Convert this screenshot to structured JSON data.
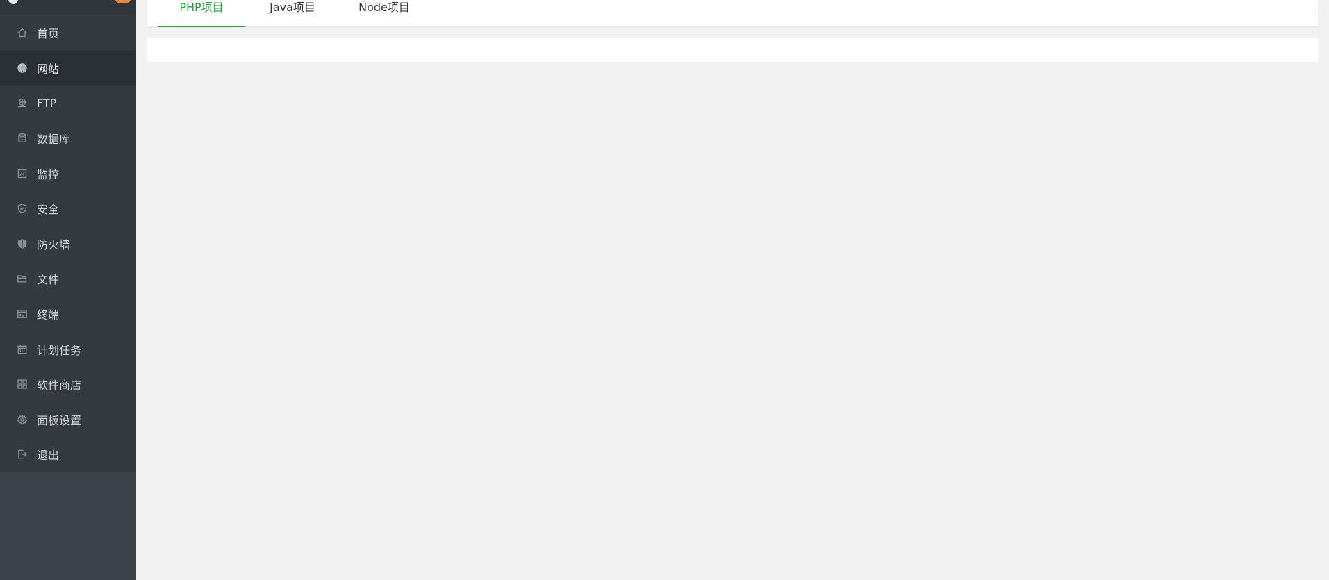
{
  "theme": {
    "sidebar_bg": "#343a40",
    "sidebar_active_bg": "#2a3036",
    "accent": "#20a53a",
    "badge": "#f0883a",
    "page_bg": "#f1f1f1"
  },
  "sidebar": {
    "items": [
      {
        "label": "首页",
        "icon": "home-icon",
        "active": false
      },
      {
        "label": "网站",
        "icon": "globe-icon",
        "active": true
      },
      {
        "label": "FTP",
        "icon": "ftp-icon",
        "active": false
      },
      {
        "label": "数据库",
        "icon": "database-icon",
        "active": false
      },
      {
        "label": "监控",
        "icon": "monitor-chart-icon",
        "active": false
      },
      {
        "label": "安全",
        "icon": "shield-check-icon",
        "active": false
      },
      {
        "label": "防火墙",
        "icon": "firewall-shield-icon",
        "active": false
      },
      {
        "label": "文件",
        "icon": "folder-icon",
        "active": false
      },
      {
        "label": "终端",
        "icon": "terminal-icon",
        "active": false
      },
      {
        "label": "计划任务",
        "icon": "calendar-icon",
        "active": false
      },
      {
        "label": "软件商店",
        "icon": "apps-grid-icon",
        "active": false
      },
      {
        "label": "面板设置",
        "icon": "gear-icon",
        "active": false
      },
      {
        "label": "退出",
        "icon": "logout-icon",
        "active": false
      }
    ]
  },
  "tabs": [
    {
      "label": "PHP项目",
      "active": true
    },
    {
      "label": "Java项目",
      "active": false
    },
    {
      "label": "Node项目",
      "active": false
    }
  ]
}
